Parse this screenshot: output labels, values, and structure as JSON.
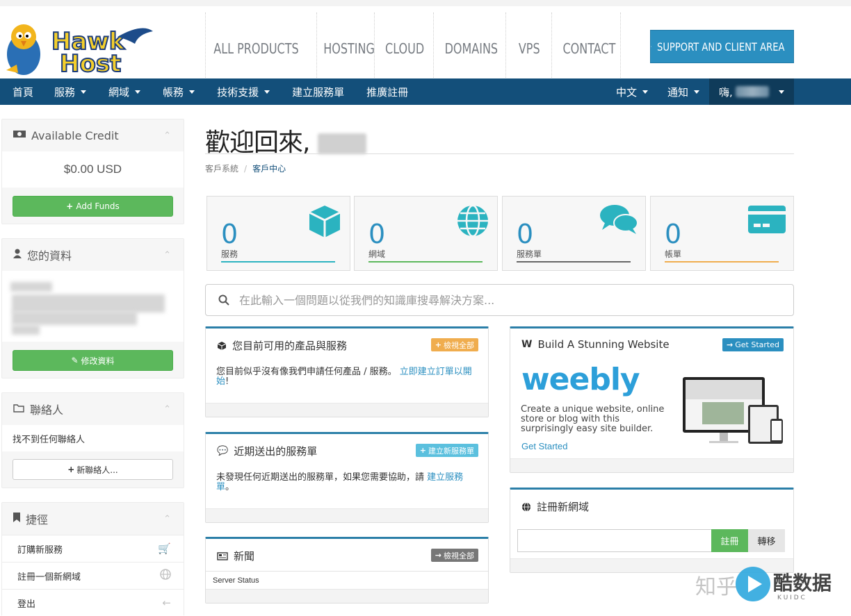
{
  "header": {
    "logo_text": "HawkHost",
    "nav": [
      "ALL PRODUCTS",
      "HOSTING",
      "CLOUD",
      "DOMAINS",
      "VPS",
      "CONTACT"
    ],
    "support_button": "SUPPORT AND CLIENT AREA"
  },
  "subnav": {
    "items": [
      {
        "label": "首頁",
        "caret": false
      },
      {
        "label": "服務",
        "caret": true
      },
      {
        "label": "網域",
        "caret": true
      },
      {
        "label": "帳務",
        "caret": true
      },
      {
        "label": "技術支援",
        "caret": true
      },
      {
        "label": "建立服務單",
        "caret": false
      },
      {
        "label": "推廣註冊",
        "caret": false
      }
    ],
    "language": "中文",
    "notifications": "通知",
    "greeting": "嗨,"
  },
  "sidebar": {
    "credit": {
      "title": "Available Credit",
      "amount": "$0.00 USD",
      "button": "Add Funds"
    },
    "profile": {
      "title": "您的資料",
      "button": "修改資料"
    },
    "contacts": {
      "title": "聯絡人",
      "empty": "找不到任何聯絡人",
      "button": "新聯絡人..."
    },
    "shortcuts": {
      "title": "捷徑",
      "items": [
        {
          "label": "訂購新服務",
          "icon": "cart-icon"
        },
        {
          "label": "註冊一個新網域",
          "icon": "globe-icon"
        },
        {
          "label": "登出",
          "icon": "arrow-left-icon"
        }
      ]
    }
  },
  "main": {
    "welcome": "歡迎回來,",
    "breadcrumb": {
      "home": "客戶系統",
      "current": "客戶中心"
    },
    "tiles": [
      {
        "count": "0",
        "label": "服務",
        "color": "#2bb3c0",
        "icon": "cube-icon"
      },
      {
        "count": "0",
        "label": "網域",
        "color": "#5cb85c",
        "icon": "globe-icon"
      },
      {
        "count": "0",
        "label": "服務單",
        "color": "#666666",
        "icon": "comments-icon"
      },
      {
        "count": "0",
        "label": "帳單",
        "color": "#f0ad4e",
        "icon": "credit-card-icon"
      }
    ],
    "search_placeholder": "在此輸入一個問題以從我們的知識庫搜尋解決方案...",
    "products": {
      "title": "您目前可用的產品與服務",
      "badge": "檢視全部",
      "text": "您目前似乎沒有像我們申請任何產品 / 服務。",
      "link": "立即建立訂單以開始",
      "end": "!"
    },
    "tickets": {
      "title": "近期送出的服務單",
      "badge": "建立新服務單",
      "text": "未發現任何近期送出的服務單，如果您需要協助，請",
      "link": "建立服務單",
      "end": "。"
    },
    "news": {
      "title": "新聞",
      "badge": "檢視全部",
      "item": "Server Status"
    },
    "weebly": {
      "title": "Build A Stunning Website",
      "badge": "Get Started",
      "logo": "weebly",
      "text": "Create a unique website, online store or blog with this surprisingly easy site builder.",
      "link": "Get Started"
    },
    "domain": {
      "title": "註冊新網域",
      "register": "註冊",
      "transfer": "轉移"
    }
  },
  "watermark": {
    "text": "知乎",
    "brand": "酷数据",
    "sub": "K U I D C"
  }
}
